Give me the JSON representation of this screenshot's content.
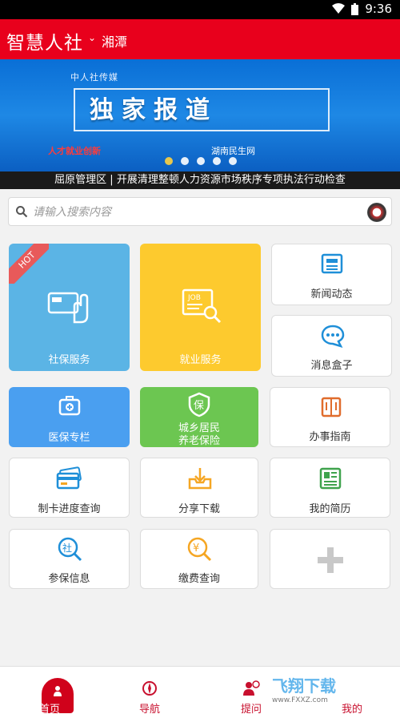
{
  "status_bar": {
    "time": "9:36"
  },
  "header": {
    "title": "智慧人社",
    "city": "湘潭"
  },
  "banner": {
    "media": "中人社传媒",
    "headline": "独家报道",
    "bottom_left": "人才就业创新",
    "bottom_right": "湖南民生网",
    "dots": 5,
    "active_dot": 0
  },
  "ticker": "屈原管理区 | 开展清理整顿人力资源市场秩序专项执法行动检查",
  "search": {
    "placeholder": "请输入搜索内容"
  },
  "tiles": {
    "social_security": {
      "label": "社保服务",
      "badge": "HOT"
    },
    "employment": {
      "label": "就业服务"
    },
    "news": {
      "label": "新闻动态"
    },
    "messages": {
      "label": "消息盒子"
    },
    "medical": {
      "label": "医保专栏"
    },
    "pension_line1": "城乡居民",
    "pension_line2": "养老保险",
    "guide": {
      "label": "办事指南"
    },
    "card_progress": {
      "label": "制卡进度查询"
    },
    "share": {
      "label": "分享下载"
    },
    "resume": {
      "label": "我的简历"
    },
    "insured_info": {
      "label": "参保信息"
    },
    "payment": {
      "label": "缴费查询"
    }
  },
  "bottom_nav": {
    "home": "首页",
    "navigation": "导航",
    "question": "提问",
    "mine": "我的"
  },
  "watermark": {
    "text": "飞翔下载",
    "url": "www.FXXZ.com"
  },
  "colors": {
    "brand": "#e8001c",
    "tile_blue": "#4a9ff0",
    "tile_yellow": "#fdca2e",
    "tile_green": "#6cc651"
  }
}
